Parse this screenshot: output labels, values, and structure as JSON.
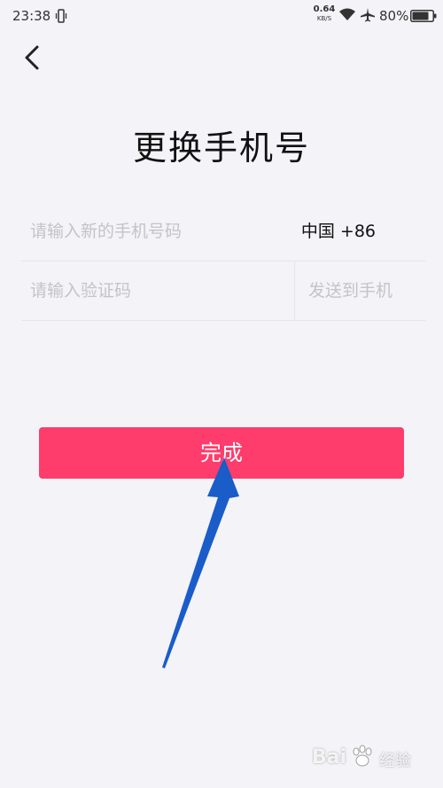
{
  "status_bar": {
    "time": "23:38",
    "net_speed_value": "0.64",
    "net_speed_unit": "KB/S",
    "battery": "80%",
    "icons": [
      "vibrate-icon",
      "wifi-icon",
      "airplane-icon",
      "battery-icon"
    ]
  },
  "nav": {
    "back_icon": "chevron-left-icon"
  },
  "page": {
    "title": "更换手机号"
  },
  "form": {
    "phone_placeholder": "请输入新的手机号码",
    "phone_value": "",
    "country_code": "中国 +86",
    "code_placeholder": "请输入验证码",
    "code_value": "",
    "send_code_label": "发送到手机"
  },
  "submit": {
    "label": "完成"
  },
  "colors": {
    "background": "#f3f3f8",
    "accent": "#fe3d6c",
    "placeholder": "#c4c4c8",
    "annotation_arrow": "#1a5cc8"
  },
  "watermark": {
    "logo_text": "Bai",
    "logo_suffix": "经验"
  }
}
